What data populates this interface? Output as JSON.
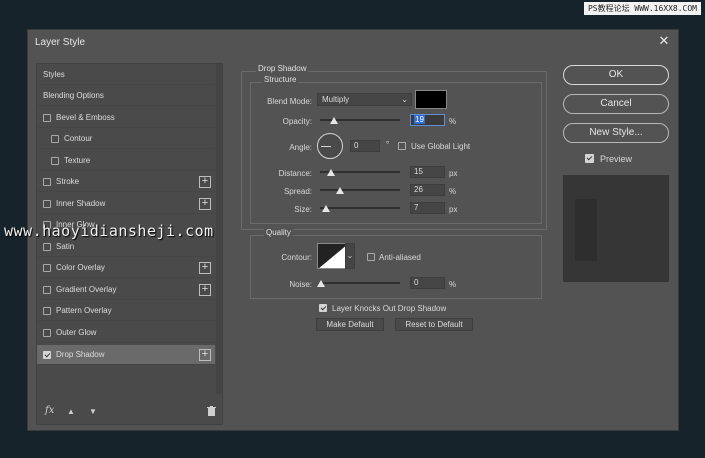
{
  "top_watermark": "PS教程论坛 WWW.16XX8.COM",
  "watermark": "www.haoyidiansheji.com",
  "dialog": {
    "title": "Layer Style"
  },
  "left_list": [
    {
      "label": "Styles",
      "checkbox": false,
      "plus": false,
      "indent": false
    },
    {
      "label": "Blending Options",
      "checkbox": false,
      "plus": false,
      "indent": false
    },
    {
      "label": "Bevel & Emboss",
      "checkbox": true,
      "checked": false,
      "plus": false,
      "indent": false
    },
    {
      "label": "Contour",
      "checkbox": true,
      "checked": false,
      "plus": false,
      "indent": true
    },
    {
      "label": "Texture",
      "checkbox": true,
      "checked": false,
      "plus": false,
      "indent": true
    },
    {
      "label": "Stroke",
      "checkbox": true,
      "checked": false,
      "plus": true,
      "indent": false
    },
    {
      "label": "Inner Shadow",
      "checkbox": true,
      "checked": false,
      "plus": true,
      "indent": false
    },
    {
      "label": "Inner Glow",
      "checkbox": true,
      "checked": false,
      "plus": false,
      "indent": false
    },
    {
      "label": "Satin",
      "checkbox": true,
      "checked": false,
      "plus": false,
      "indent": false
    },
    {
      "label": "Color Overlay",
      "checkbox": true,
      "checked": false,
      "plus": true,
      "indent": false
    },
    {
      "label": "Gradient Overlay",
      "checkbox": true,
      "checked": false,
      "plus": true,
      "indent": false
    },
    {
      "label": "Pattern Overlay",
      "checkbox": true,
      "checked": false,
      "plus": false,
      "indent": false
    },
    {
      "label": "Outer Glow",
      "checkbox": true,
      "checked": false,
      "plus": false,
      "indent": false
    },
    {
      "label": "Drop Shadow",
      "checkbox": true,
      "checked": true,
      "plus": true,
      "indent": false,
      "selected": true
    }
  ],
  "bottom_tools": {
    "fx": "fx",
    "up": "▲",
    "down": "▼",
    "trash": "🗑"
  },
  "drop_shadow": {
    "section_title": "Drop Shadow",
    "structure_title": "Structure",
    "blend_mode_label": "Blend Mode:",
    "blend_mode_value": "Multiply",
    "shadow_color": "#000000",
    "opacity_label": "Opacity:",
    "opacity_value": "19",
    "opacity_unit": "%",
    "angle_label": "Angle:",
    "angle_value": "0",
    "angle_unit": "°",
    "use_global_light_label": "Use Global Light",
    "use_global_light_checked": false,
    "distance_label": "Distance:",
    "distance_value": "15",
    "distance_unit": "px",
    "spread_label": "Spread:",
    "spread_value": "26",
    "spread_unit": "%",
    "size_label": "Size:",
    "size_value": "7",
    "size_unit": "px",
    "quality_title": "Quality",
    "contour_label": "Contour:",
    "anti_aliased_label": "Anti-aliased",
    "anti_aliased_checked": false,
    "noise_label": "Noise:",
    "noise_value": "0",
    "noise_unit": "%",
    "layer_knocks_out_label": "Layer Knocks Out Drop Shadow",
    "layer_knocks_out_checked": true,
    "make_default_label": "Make Default",
    "reset_default_label": "Reset to Default"
  },
  "buttons": {
    "ok": "OK",
    "cancel": "Cancel",
    "new_style": "New Style...",
    "preview_label": "Preview",
    "preview_checked": true
  }
}
